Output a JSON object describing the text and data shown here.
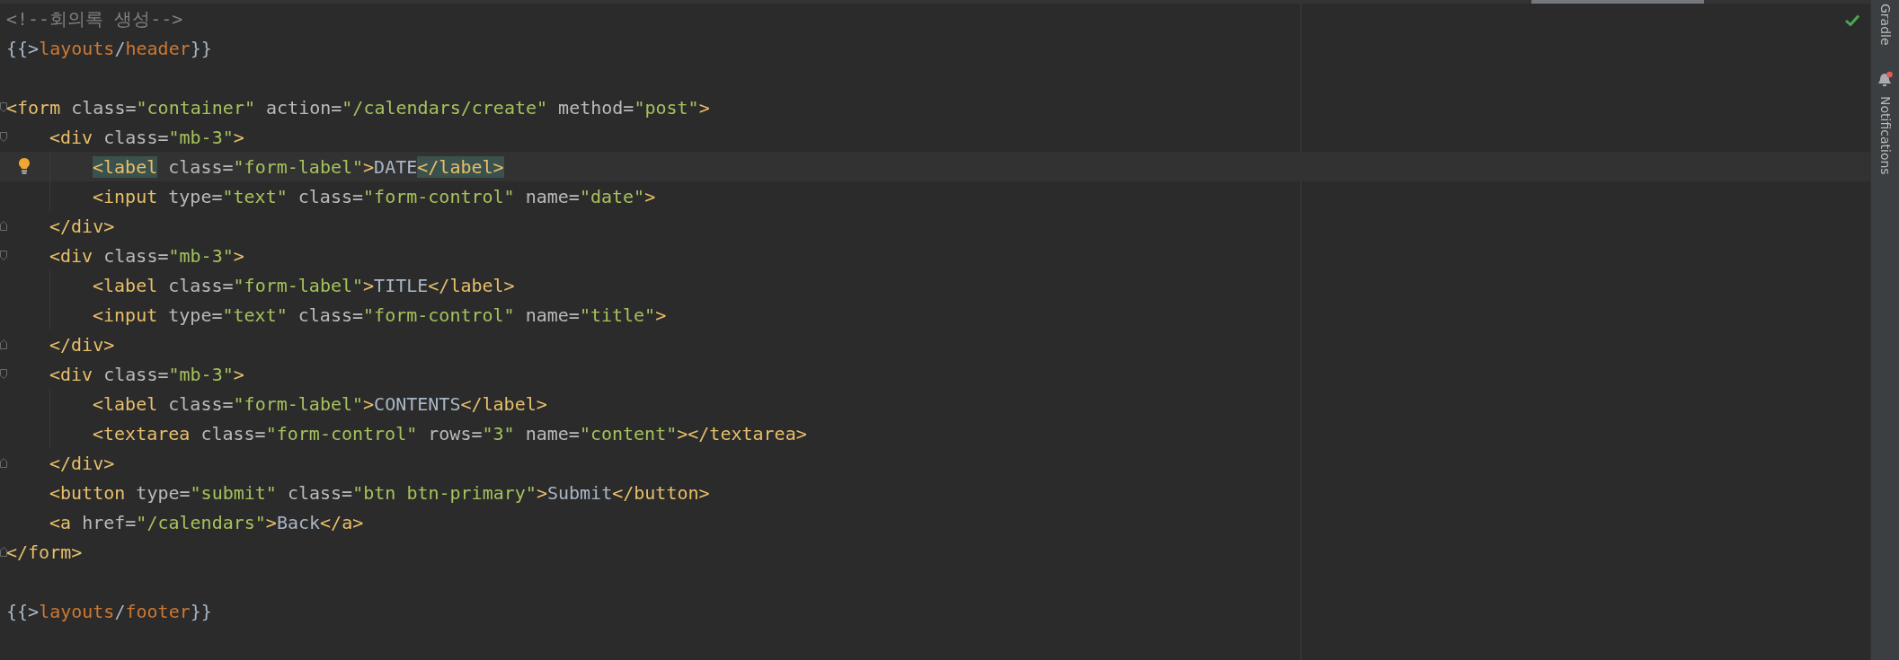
{
  "editor": {
    "lines": [
      {
        "kind": "code",
        "tokens": [
          {
            "text": "<!--회의록 생성-->",
            "kind": "comment"
          }
        ]
      },
      {
        "kind": "code",
        "tokens": [
          {
            "text": "{{>",
            "kind": "brace"
          },
          {
            "text": "layouts",
            "kind": "path"
          },
          {
            "text": "/",
            "kind": "brace"
          },
          {
            "text": "header",
            "kind": "path"
          },
          {
            "text": "}}",
            "kind": "brace"
          }
        ]
      },
      {
        "kind": "blank"
      },
      {
        "kind": "code",
        "fold": {
          "kind": "start"
        },
        "tokens": [
          {
            "text": "<form",
            "kind": "tag"
          },
          {
            "text": " class=",
            "kind": "attr"
          },
          {
            "text": "\"container\"",
            "kind": "value"
          },
          {
            "text": " action=",
            "kind": "attr"
          },
          {
            "text": "\"/calendars/create\"",
            "kind": "value"
          },
          {
            "text": " method=",
            "kind": "attr"
          },
          {
            "text": "\"post\"",
            "kind": "value"
          },
          {
            "text": ">",
            "kind": "tag"
          }
        ],
        "children": [
          {
            "kind": "code",
            "fold": {
              "kind": "start"
            },
            "tokens": [
              {
                "text": "<div",
                "kind": "tag"
              },
              {
                "text": " class=",
                "kind": "attr"
              },
              {
                "text": "\"mb-3\"",
                "kind": "value"
              },
              {
                "text": ">",
                "kind": "tag"
              }
            ],
            "children": [
              {
                "kind": "code",
                "current": true,
                "bulb": true,
                "tokens": [
                  {
                    "text": "<label",
                    "kind": "tag",
                    "match": true
                  },
                  {
                    "text": " class=",
                    "kind": "attr"
                  },
                  {
                    "text": "\"form-label\"",
                    "kind": "value"
                  },
                  {
                    "text": ">",
                    "kind": "tag"
                  },
                  {
                    "text": "DATE",
                    "kind": "text"
                  },
                  {
                    "text": "</label>",
                    "kind": "tag",
                    "match": true
                  }
                ]
              },
              {
                "kind": "code",
                "tokens": [
                  {
                    "text": "<input",
                    "kind": "tag"
                  },
                  {
                    "text": " type=",
                    "kind": "attr"
                  },
                  {
                    "text": "\"text\"",
                    "kind": "value"
                  },
                  {
                    "text": " class=",
                    "kind": "attr"
                  },
                  {
                    "text": "\"form-control\"",
                    "kind": "value"
                  },
                  {
                    "text": " name=",
                    "kind": "attr"
                  },
                  {
                    "text": "\"date\"",
                    "kind": "value"
                  },
                  {
                    "text": ">",
                    "kind": "tag"
                  }
                ]
              }
            ]
          },
          {
            "kind": "code",
            "fold": {
              "kind": "end"
            },
            "tokens": [
              {
                "text": "</div>",
                "kind": "tag"
              }
            ]
          },
          {
            "kind": "code",
            "fold": {
              "kind": "start"
            },
            "tokens": [
              {
                "text": "<div",
                "kind": "tag"
              },
              {
                "text": " class=",
                "kind": "attr"
              },
              {
                "text": "\"mb-3\"",
                "kind": "value"
              },
              {
                "text": ">",
                "kind": "tag"
              }
            ],
            "children": [
              {
                "kind": "code",
                "tokens": [
                  {
                    "text": "<label",
                    "kind": "tag"
                  },
                  {
                    "text": " class=",
                    "kind": "attr"
                  },
                  {
                    "text": "\"form-label\"",
                    "kind": "value"
                  },
                  {
                    "text": ">",
                    "kind": "tag"
                  },
                  {
                    "text": "TITLE",
                    "kind": "text"
                  },
                  {
                    "text": "</label>",
                    "kind": "tag"
                  }
                ]
              },
              {
                "kind": "code",
                "tokens": [
                  {
                    "text": "<input",
                    "kind": "tag"
                  },
                  {
                    "text": " type=",
                    "kind": "attr"
                  },
                  {
                    "text": "\"text\"",
                    "kind": "value"
                  },
                  {
                    "text": " class=",
                    "kind": "attr"
                  },
                  {
                    "text": "\"form-control\"",
                    "kind": "value"
                  },
                  {
                    "text": " name=",
                    "kind": "attr"
                  },
                  {
                    "text": "\"title\"",
                    "kind": "value"
                  },
                  {
                    "text": ">",
                    "kind": "tag"
                  }
                ]
              }
            ]
          },
          {
            "kind": "code",
            "fold": {
              "kind": "end"
            },
            "tokens": [
              {
                "text": "</div>",
                "kind": "tag"
              }
            ]
          },
          {
            "kind": "code",
            "fold": {
              "kind": "start"
            },
            "tokens": [
              {
                "text": "<div",
                "kind": "tag"
              },
              {
                "text": " class=",
                "kind": "attr"
              },
              {
                "text": "\"mb-3\"",
                "kind": "value"
              },
              {
                "text": ">",
                "kind": "tag"
              }
            ],
            "children": [
              {
                "kind": "code",
                "tokens": [
                  {
                    "text": "<label",
                    "kind": "tag"
                  },
                  {
                    "text": " class=",
                    "kind": "attr"
                  },
                  {
                    "text": "\"form-label\"",
                    "kind": "value"
                  },
                  {
                    "text": ">",
                    "kind": "tag"
                  },
                  {
                    "text": "CONTENTS",
                    "kind": "text"
                  },
                  {
                    "text": "</label>",
                    "kind": "tag"
                  }
                ]
              },
              {
                "kind": "code",
                "tokens": [
                  {
                    "text": "<textarea",
                    "kind": "tag"
                  },
                  {
                    "text": " class=",
                    "kind": "attr"
                  },
                  {
                    "text": "\"form-control\"",
                    "kind": "value"
                  },
                  {
                    "text": " rows=",
                    "kind": "attr"
                  },
                  {
                    "text": "\"3\"",
                    "kind": "value"
                  },
                  {
                    "text": " name=",
                    "kind": "attr"
                  },
                  {
                    "text": "\"content\"",
                    "kind": "value"
                  },
                  {
                    "text": "></textarea>",
                    "kind": "tag"
                  }
                ]
              }
            ]
          },
          {
            "kind": "code",
            "fold": {
              "kind": "end"
            },
            "tokens": [
              {
                "text": "</div>",
                "kind": "tag"
              }
            ]
          },
          {
            "kind": "code",
            "tokens": [
              {
                "text": "<button",
                "kind": "tag"
              },
              {
                "text": " type=",
                "kind": "attr"
              },
              {
                "text": "\"submit\"",
                "kind": "value"
              },
              {
                "text": " class=",
                "kind": "attr"
              },
              {
                "text": "\"btn btn-primary\"",
                "kind": "value"
              },
              {
                "text": ">",
                "kind": "tag"
              },
              {
                "text": "Submit",
                "kind": "text"
              },
              {
                "text": "</button>",
                "kind": "tag"
              }
            ]
          },
          {
            "kind": "code",
            "tokens": [
              {
                "text": "<a",
                "kind": "tag"
              },
              {
                "text": " href=",
                "kind": "attr"
              },
              {
                "text": "\"/calendars\"",
                "kind": "value"
              },
              {
                "text": ">",
                "kind": "tag"
              },
              {
                "text": "Back",
                "kind": "text"
              },
              {
                "text": "</a>",
                "kind": "tag"
              }
            ]
          }
        ]
      },
      {
        "kind": "code",
        "fold": {
          "kind": "end"
        },
        "tokens": [
          {
            "text": "</form>",
            "kind": "tag"
          }
        ]
      },
      {
        "kind": "blank"
      },
      {
        "kind": "code",
        "tokens": [
          {
            "text": "{{>",
            "kind": "brace"
          },
          {
            "text": "layouts",
            "kind": "path"
          },
          {
            "text": "/",
            "kind": "brace"
          },
          {
            "text": "footer",
            "kind": "path"
          },
          {
            "text": "}}",
            "kind": "brace"
          }
        ]
      }
    ],
    "inspection": {
      "kind": "ok"
    }
  },
  "tool_strip": {
    "items": [
      {
        "kind": "text",
        "label": "Gradle"
      },
      {
        "kind": "bell",
        "label": "Notifications",
        "unread": true
      }
    ]
  }
}
